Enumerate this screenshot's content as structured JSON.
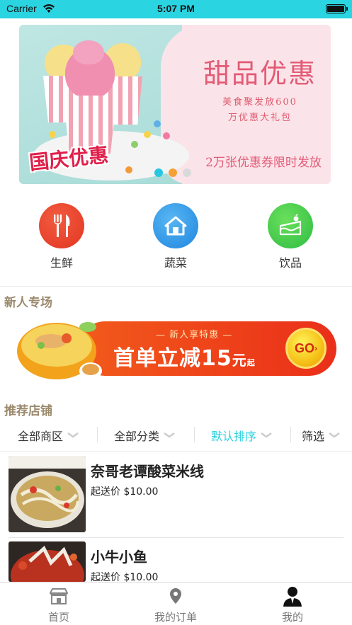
{
  "status_bar": {
    "carrier": "Carrier",
    "time": "5:07 PM"
  },
  "banner": {
    "title": "甜品优惠",
    "subtitle_line1": "美食聚发放600",
    "subtitle_line2": "万优惠大礼包",
    "promo_text": "2万张优惠券限时发放",
    "tag": "国庆优惠",
    "page_count": 3,
    "active_page": 2
  },
  "categories": [
    {
      "label": "生鲜",
      "icon": "fork-knife-icon",
      "color": "#e63b27"
    },
    {
      "label": "蔬菜",
      "icon": "home-icon",
      "color": "#2f95e8"
    },
    {
      "label": "饮品",
      "icon": "cake-icon",
      "color": "#3cc94a"
    }
  ],
  "newcomer": {
    "section_title": "新人专场",
    "badge": "新人享特惠",
    "headline": "首单立减",
    "amount": "15",
    "unit": "元",
    "suffix": "起",
    "go_label": "GO"
  },
  "shops_section": {
    "title": "推荐店铺",
    "filters": [
      {
        "label": "全部商区",
        "active": false
      },
      {
        "label": "全部分类",
        "active": false
      },
      {
        "label": "默认排序",
        "active": true
      },
      {
        "label": "筛选",
        "active": false
      }
    ],
    "items": [
      {
        "name": "奈哥老谭酸菜米线",
        "price": "起送价 $10.00"
      },
      {
        "name": "小牛小鱼",
        "price": "起送价 $10.00"
      }
    ]
  },
  "tabbar": {
    "items": [
      {
        "label": "首页",
        "icon": "storefront-icon"
      },
      {
        "label": "我的订单",
        "icon": "location-pin-icon"
      },
      {
        "label": "我的",
        "icon": "user-profile-icon"
      }
    ]
  },
  "colors": {
    "accent": "#2ad4e0",
    "section_title": "#9c8a6d",
    "promo_red": "#ea2f1a"
  }
}
